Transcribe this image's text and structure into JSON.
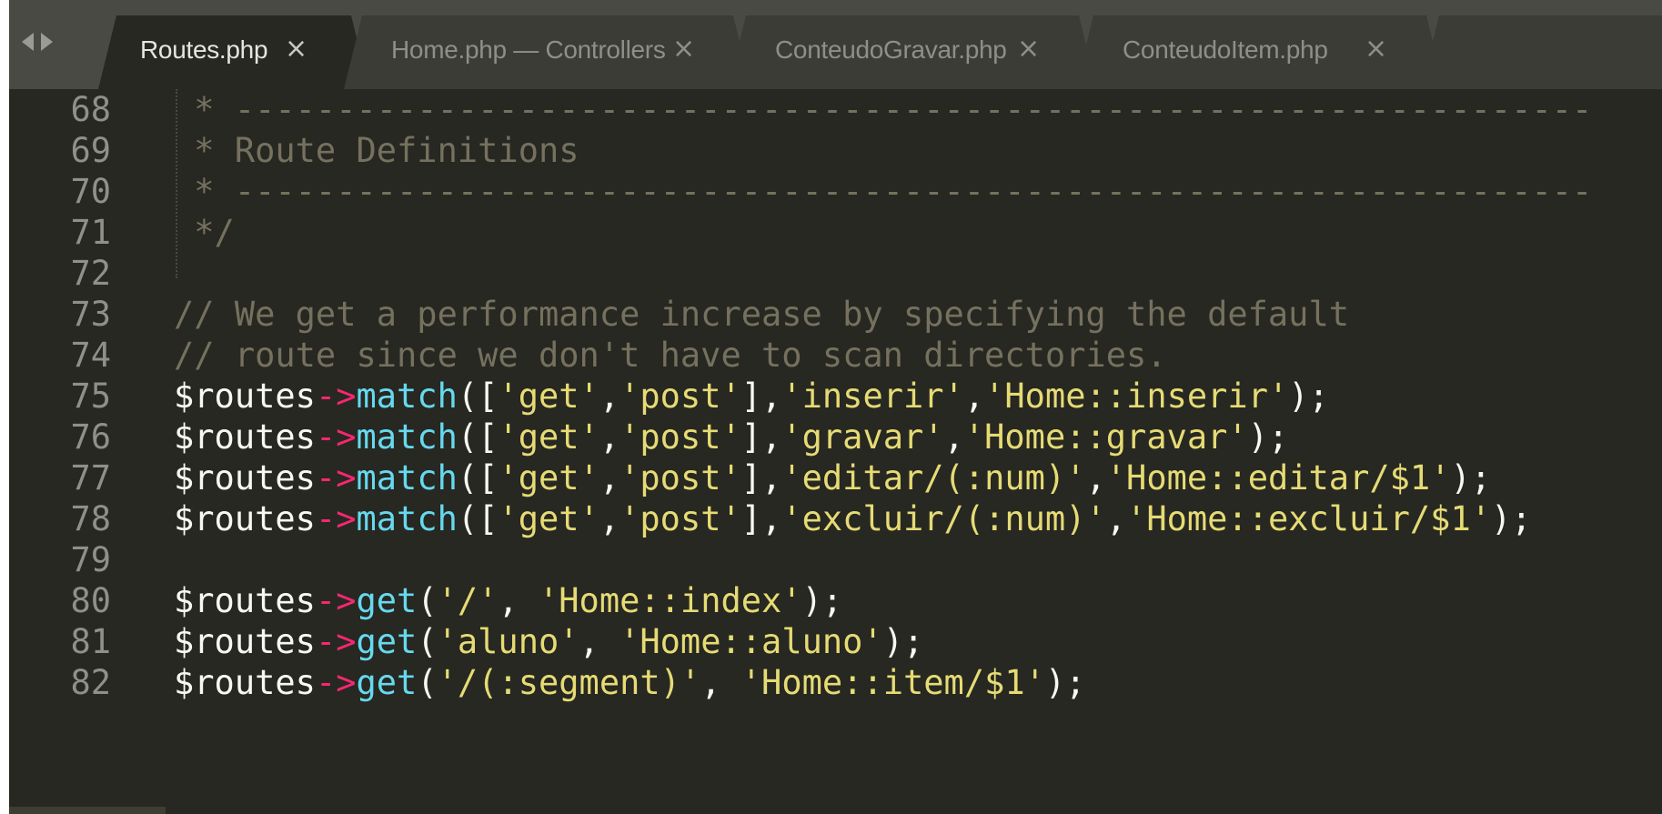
{
  "tabs": [
    {
      "label": "Routes.php",
      "close": "×",
      "active": true
    },
    {
      "label": "Home.php — Controllers",
      "close": "×",
      "active": false
    },
    {
      "label": "ConteudoGravar.php",
      "close": "×",
      "active": false
    },
    {
      "label": "ConteudoItem.php",
      "close": "×",
      "active": false
    }
  ],
  "colors": {
    "background": "#272822",
    "comment": "#75715e",
    "string": "#e6db74",
    "function": "#66d9ef",
    "operator": "#f92672",
    "plain": "#f8f8f2",
    "line_number": "#8f908a"
  },
  "lines": [
    {
      "num": "68",
      "tokens": [
        {
          "t": "c",
          "text": " * -------------------------------------------------------------------"
        }
      ]
    },
    {
      "num": "69",
      "tokens": [
        {
          "t": "c",
          "text": " * Route Definitions"
        }
      ]
    },
    {
      "num": "70",
      "tokens": [
        {
          "t": "c",
          "text": " * -------------------------------------------------------------------"
        }
      ]
    },
    {
      "num": "71",
      "tokens": [
        {
          "t": "c",
          "text": " */"
        }
      ]
    },
    {
      "num": "72",
      "tokens": []
    },
    {
      "num": "73",
      "tokens": [
        {
          "t": "c",
          "text": "// We get a performance increase by specifying the default"
        }
      ]
    },
    {
      "num": "74",
      "tokens": [
        {
          "t": "c",
          "text": "// route since we don't have to scan directories."
        }
      ]
    },
    {
      "num": "75",
      "tokens": [
        {
          "t": "v",
          "text": "$routes"
        },
        {
          "t": "o",
          "text": "->"
        },
        {
          "t": "f",
          "text": "match"
        },
        {
          "t": "p",
          "text": "(["
        },
        {
          "t": "s",
          "text": "'get'"
        },
        {
          "t": "p",
          "text": ","
        },
        {
          "t": "s",
          "text": "'post'"
        },
        {
          "t": "p",
          "text": "],"
        },
        {
          "t": "s",
          "text": "'inserir'"
        },
        {
          "t": "p",
          "text": ","
        },
        {
          "t": "s",
          "text": "'Home::inserir'"
        },
        {
          "t": "p",
          "text": ");"
        }
      ]
    },
    {
      "num": "76",
      "tokens": [
        {
          "t": "v",
          "text": "$routes"
        },
        {
          "t": "o",
          "text": "->"
        },
        {
          "t": "f",
          "text": "match"
        },
        {
          "t": "p",
          "text": "(["
        },
        {
          "t": "s",
          "text": "'get'"
        },
        {
          "t": "p",
          "text": ","
        },
        {
          "t": "s",
          "text": "'post'"
        },
        {
          "t": "p",
          "text": "],"
        },
        {
          "t": "s",
          "text": "'gravar'"
        },
        {
          "t": "p",
          "text": ","
        },
        {
          "t": "s",
          "text": "'Home::gravar'"
        },
        {
          "t": "p",
          "text": ");"
        }
      ]
    },
    {
      "num": "77",
      "tokens": [
        {
          "t": "v",
          "text": "$routes"
        },
        {
          "t": "o",
          "text": "->"
        },
        {
          "t": "f",
          "text": "match"
        },
        {
          "t": "p",
          "text": "(["
        },
        {
          "t": "s",
          "text": "'get'"
        },
        {
          "t": "p",
          "text": ","
        },
        {
          "t": "s",
          "text": "'post'"
        },
        {
          "t": "p",
          "text": "],"
        },
        {
          "t": "s",
          "text": "'editar/(:num)'"
        },
        {
          "t": "p",
          "text": ","
        },
        {
          "t": "s",
          "text": "'Home::editar/$1'"
        },
        {
          "t": "p",
          "text": ");"
        }
      ]
    },
    {
      "num": "78",
      "tokens": [
        {
          "t": "v",
          "text": "$routes"
        },
        {
          "t": "o",
          "text": "->"
        },
        {
          "t": "f",
          "text": "match"
        },
        {
          "t": "p",
          "text": "(["
        },
        {
          "t": "s",
          "text": "'get'"
        },
        {
          "t": "p",
          "text": ","
        },
        {
          "t": "s",
          "text": "'post'"
        },
        {
          "t": "p",
          "text": "],"
        },
        {
          "t": "s",
          "text": "'excluir/(:num)'"
        },
        {
          "t": "p",
          "text": ","
        },
        {
          "t": "s",
          "text": "'Home::excluir/$1'"
        },
        {
          "t": "p",
          "text": ");"
        }
      ]
    },
    {
      "num": "79",
      "tokens": []
    },
    {
      "num": "80",
      "tokens": [
        {
          "t": "v",
          "text": "$routes"
        },
        {
          "t": "o",
          "text": "->"
        },
        {
          "t": "f",
          "text": "get"
        },
        {
          "t": "p",
          "text": "("
        },
        {
          "t": "s",
          "text": "'/'"
        },
        {
          "t": "p",
          "text": ", "
        },
        {
          "t": "s",
          "text": "'Home::index'"
        },
        {
          "t": "p",
          "text": ");"
        }
      ]
    },
    {
      "num": "81",
      "tokens": [
        {
          "t": "v",
          "text": "$routes"
        },
        {
          "t": "o",
          "text": "->"
        },
        {
          "t": "f",
          "text": "get"
        },
        {
          "t": "p",
          "text": "("
        },
        {
          "t": "s",
          "text": "'aluno'"
        },
        {
          "t": "p",
          "text": ", "
        },
        {
          "t": "s",
          "text": "'Home::aluno'"
        },
        {
          "t": "p",
          "text": ");"
        }
      ]
    },
    {
      "num": "82",
      "tokens": [
        {
          "t": "v",
          "text": "$routes"
        },
        {
          "t": "o",
          "text": "->"
        },
        {
          "t": "f",
          "text": "get"
        },
        {
          "t": "p",
          "text": "("
        },
        {
          "t": "s",
          "text": "'/(:segment)'"
        },
        {
          "t": "p",
          "text": ", "
        },
        {
          "t": "s",
          "text": "'Home::item/$1'"
        },
        {
          "t": "p",
          "text": ");"
        }
      ]
    }
  ]
}
